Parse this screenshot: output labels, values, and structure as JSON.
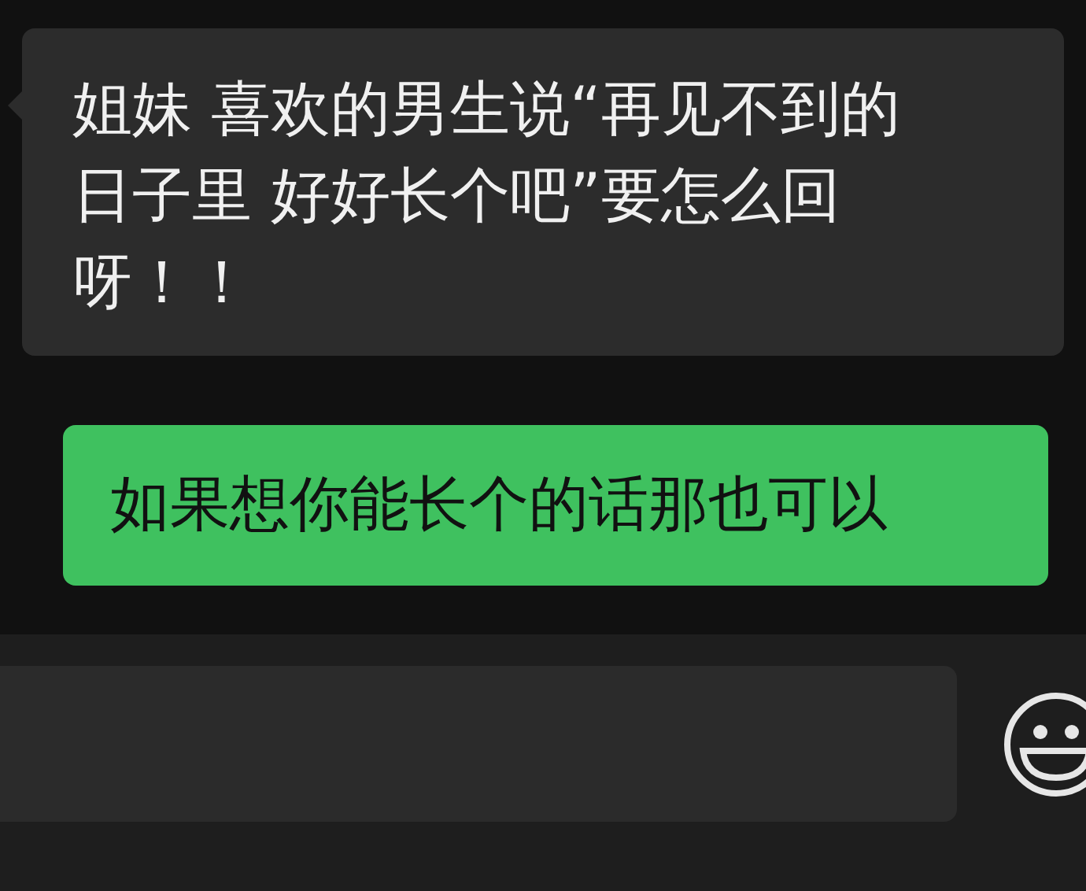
{
  "messages": [
    {
      "kind": "received",
      "text": "姐妹 喜欢的男生说“再见不到的日子里 好好长个吧”要怎么回呀！！"
    },
    {
      "kind": "sent",
      "text": "如果想你能长个的话那也可以"
    }
  ],
  "composer": {
    "kind": "input"
  }
}
